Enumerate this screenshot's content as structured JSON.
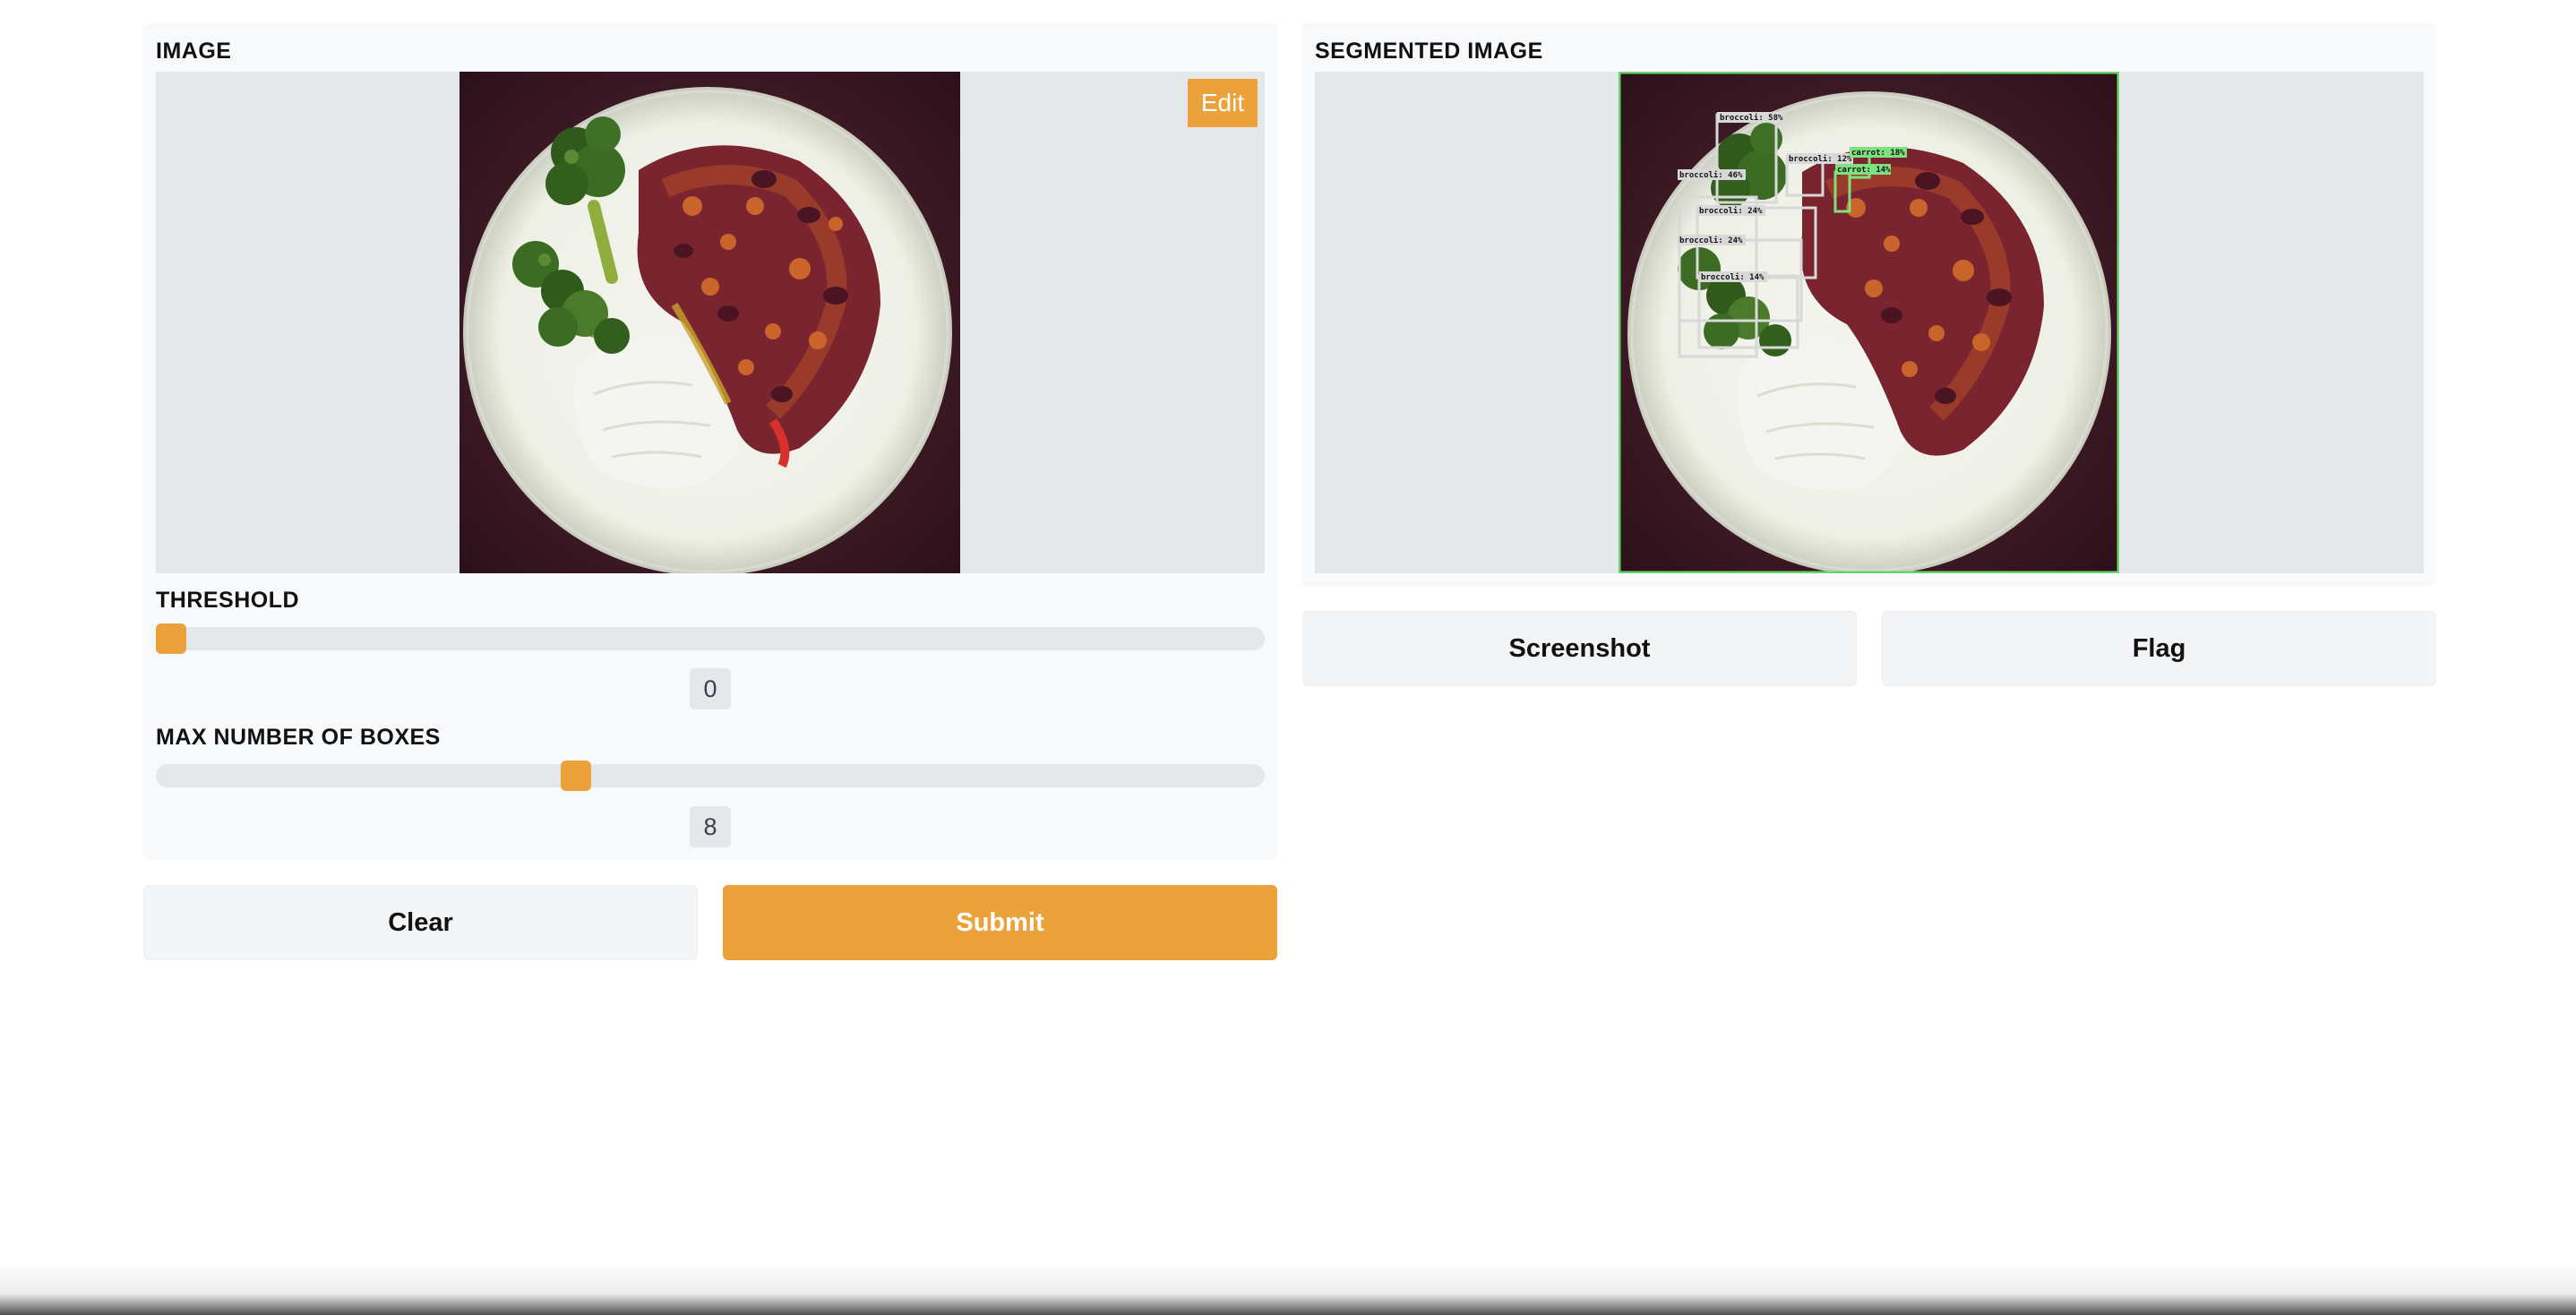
{
  "input_panel": {
    "image_label": "IMAGE",
    "edit_label": "Edit",
    "threshold": {
      "label": "THRESHOLD",
      "value": "0",
      "fraction": 0.0
    },
    "max_boxes": {
      "label": "MAX NUMBER OF BOXES",
      "value": "8",
      "fraction": 0.375
    }
  },
  "actions": {
    "clear_label": "Clear",
    "submit_label": "Submit"
  },
  "output_panel": {
    "label": "SEGMENTED IMAGE",
    "detections": [
      {
        "label": "broccoli: 58%",
        "color": "#d8d8d8"
      },
      {
        "label": "broccoli: 12%",
        "color": "#d8d8d8"
      },
      {
        "label": "carrot: 18%",
        "color": "#7ee07e"
      },
      {
        "label": "carrot: 14%",
        "color": "#7ee07e"
      },
      {
        "label": "broccoli: 46%",
        "color": "#d8d8d8"
      },
      {
        "label": "broccoli: 24%",
        "color": "#d8d8d8"
      },
      {
        "label": "broccoli: 24%",
        "color": "#d8d8d8"
      },
      {
        "label": "broccoli: 14%",
        "color": "#d8d8d8"
      }
    ]
  },
  "output_actions": {
    "screenshot_label": "Screenshot",
    "flag_label": "Flag"
  },
  "colors": {
    "accent": "#eba23b",
    "panel": "#f8f9fb",
    "image_bg": "#e5e7eb"
  }
}
